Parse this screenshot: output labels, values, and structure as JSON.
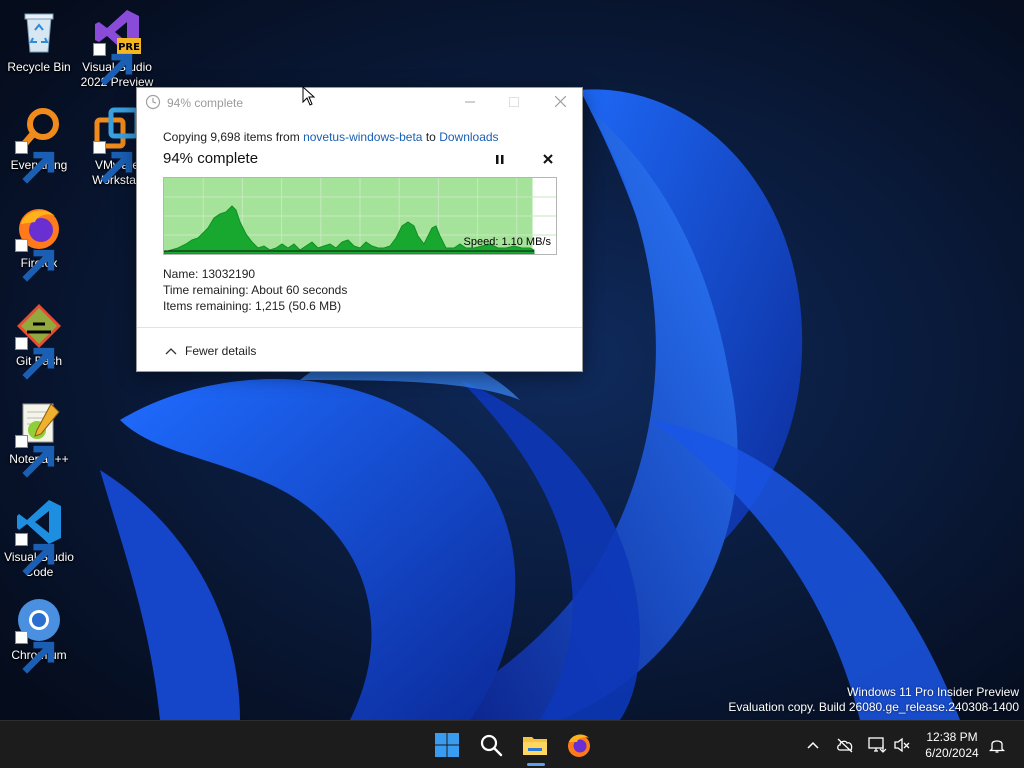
{
  "desktop": {
    "icons": [
      {
        "label": "Recycle Bin"
      },
      {
        "label": "Visual Studio 2022 Preview",
        "badge": "PRE"
      },
      {
        "label": "Everything"
      },
      {
        "label": "VMware Workstati"
      },
      {
        "label": "Firefox"
      },
      {
        "label": "Git Bash"
      },
      {
        "label": "Notepad++"
      },
      {
        "label": "Visual Studio Code"
      },
      {
        "label": "Chromium"
      }
    ]
  },
  "dialog": {
    "title": "94% complete",
    "copy_prefix": "Copying 9,698 items from",
    "source": "novetus-windows-beta",
    "to_word": "to",
    "destination": "Downloads",
    "percent_text": "94% complete",
    "progress_percent": 94,
    "speed_label": "Speed: 1.10 MB/s",
    "name_label": "Name:",
    "name_value": "13032190",
    "time_label": "Time remaining:",
    "time_value": "About 60 seconds",
    "items_label": "Items remaining:",
    "items_value": "1,215 (50.6 MB)",
    "fewer_details": "Fewer details"
  },
  "watermark": {
    "line1": "Windows 11 Pro Insider Preview",
    "line2": "Evaluation copy. Build 26080.ge_release.240308-1400"
  },
  "taskbar": {
    "time": "12:38 PM",
    "date": "6/20/2024",
    "accent_color": "#5ea0ef"
  },
  "colors": {
    "graph_fill": "#18a830",
    "graph_bg": "#a6e39a",
    "link": "#1a5fb4"
  }
}
